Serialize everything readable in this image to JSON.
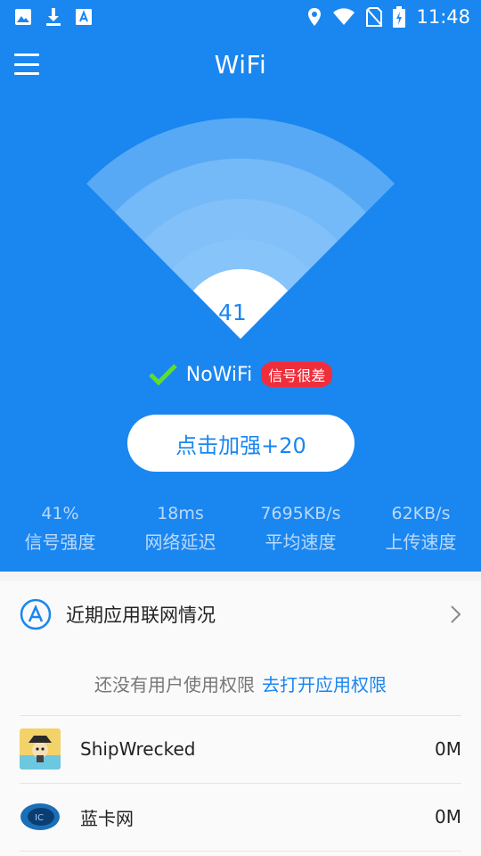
{
  "status_bar": {
    "time": "11:48",
    "left_icons": [
      "image-icon",
      "download-icon",
      "font-icon"
    ],
    "right_icons": [
      "location-icon",
      "wifi-icon",
      "no-sim-icon",
      "battery-charging-icon"
    ]
  },
  "app_bar": {
    "title": "WiFi"
  },
  "wifi_meter": {
    "value": "41"
  },
  "network": {
    "name": "NoWiFi",
    "badge": "信号很差"
  },
  "boost_button": {
    "label": "点击加强+20"
  },
  "stats": [
    {
      "value": "41%",
      "label": "信号强度"
    },
    {
      "value": "18ms",
      "label": "网络延迟"
    },
    {
      "value": "7695KB/s",
      "label": "平均速度"
    },
    {
      "value": "62KB/s",
      "label": "上传速度"
    }
  ],
  "recent_apps": {
    "title": "近期应用联网情况",
    "permission_text": "还没有用户使用权限",
    "permission_link": "去打开应用权限",
    "apps": [
      {
        "name": "ShipWrecked",
        "size": "0M"
      },
      {
        "name": "蓝卡网",
        "size": "0M"
      }
    ]
  },
  "colors": {
    "primary": "#1a86f0",
    "badge_red": "#ee2f3b",
    "check_green": "#5dde2e"
  }
}
